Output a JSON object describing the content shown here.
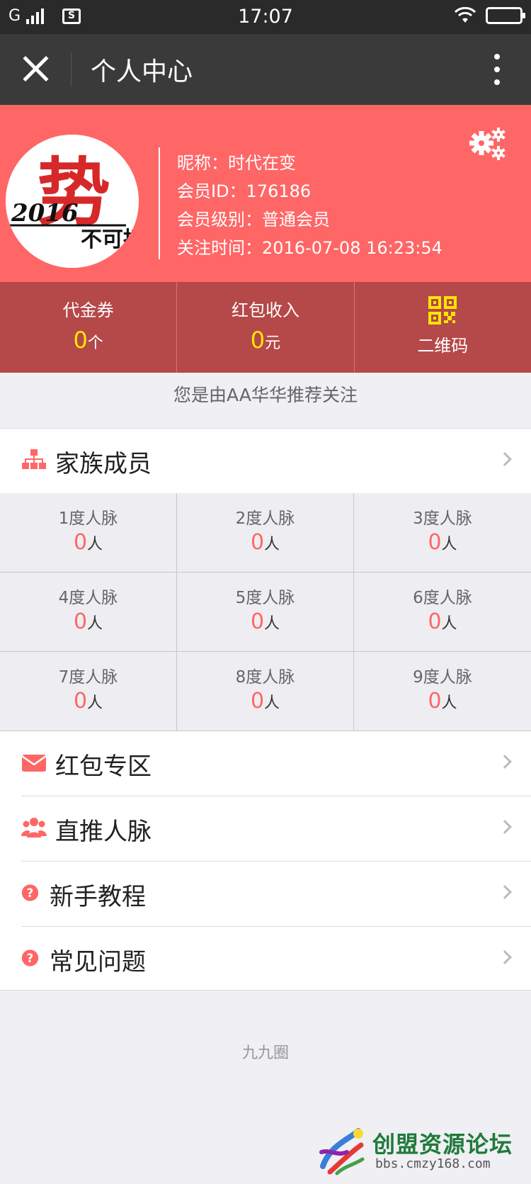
{
  "status_bar": {
    "network": "G",
    "time": "17:07"
  },
  "nav": {
    "title": "个人中心"
  },
  "profile": {
    "nickname": "昵称：时代在变",
    "member_id": "会员ID：176186",
    "level": "会员级别：普通会员",
    "follow_time": "关注时间：2016-07-08 16:23:54",
    "avatar_text_year": "2016",
    "avatar_text_main": "势",
    "avatar_text_sub": "不可挡"
  },
  "stats": {
    "voucher_label": "代金券",
    "voucher_value": "0",
    "voucher_unit": "个",
    "redpacket_label": "红包收入",
    "redpacket_value": "0",
    "redpacket_unit": "元",
    "qrcode_label": "二维码"
  },
  "referrer": "您是由AA华华推荐关注",
  "family": {
    "title": "家族成员",
    "degrees": [
      {
        "label": "1度人脉",
        "value": "0",
        "unit": "人"
      },
      {
        "label": "2度人脉",
        "value": "0",
        "unit": "人"
      },
      {
        "label": "3度人脉",
        "value": "0",
        "unit": "人"
      },
      {
        "label": "4度人脉",
        "value": "0",
        "unit": "人"
      },
      {
        "label": "5度人脉",
        "value": "0",
        "unit": "人"
      },
      {
        "label": "6度人脉",
        "value": "0",
        "unit": "人"
      },
      {
        "label": "7度人脉",
        "value": "0",
        "unit": "人"
      },
      {
        "label": "8度人脉",
        "value": "0",
        "unit": "人"
      },
      {
        "label": "9度人脉",
        "value": "0",
        "unit": "人"
      }
    ]
  },
  "menu": {
    "items": [
      {
        "label": "红包专区",
        "icon": "envelope-icon"
      },
      {
        "label": "直推人脉",
        "icon": "users-icon"
      },
      {
        "label": "新手教程",
        "icon": "question-icon"
      },
      {
        "label": "常见问题",
        "icon": "question-icon"
      }
    ]
  },
  "footer": "九九圈",
  "watermark": {
    "title": "创盟资源论坛",
    "url": "bbs.cmzy168.com"
  },
  "colors": {
    "accent": "#ff6666",
    "stats_bg": "#b54848",
    "highlight": "#ffe600"
  }
}
